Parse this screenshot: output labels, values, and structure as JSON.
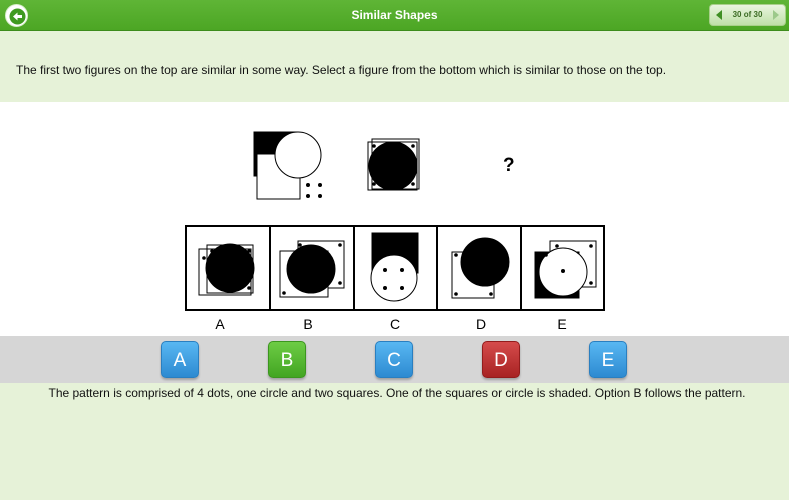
{
  "header": {
    "title": "Similar Shapes",
    "pager_text": "30 of 30",
    "color": "#4ca624"
  },
  "question": {
    "text": "The first two figures on the top are similar in some way. Select a figure from the bottom which is similar to those on the top."
  },
  "puzzle": {
    "missing_mark": "?",
    "option_labels": [
      "A",
      "B",
      "C",
      "D",
      "E"
    ]
  },
  "answers": [
    {
      "label": "A",
      "color": "blue"
    },
    {
      "label": "B",
      "color": "green"
    },
    {
      "label": "C",
      "color": "blue"
    },
    {
      "label": "D",
      "color": "red"
    },
    {
      "label": "E",
      "color": "blue"
    }
  ],
  "explanation": {
    "text": "The pattern is comprised of 4 dots, one circle and two squares. One of the squares or circle is shaded. Option B follows the pattern."
  }
}
